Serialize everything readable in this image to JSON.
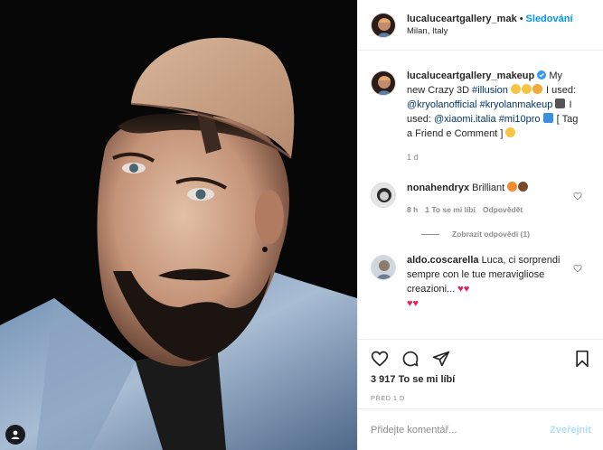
{
  "post": {
    "author": "lucaluceartgallery_mak",
    "follow_label": "Sledování",
    "location": "Milan, Italy"
  },
  "caption": {
    "username": "lucaluceartgallery_makeup",
    "text_1": "My new Crazy 3D",
    "hashtag_illusion": "#illusion",
    "text_2": "I used:",
    "mention_kryolan": "@kryolanofficial",
    "hashtag_kryolan": "#kryolanmakeup",
    "text_3": "I used:",
    "mention_xiaomi": "@xiaomi.italia",
    "hashtag_mi10pro": "#mi10pro",
    "text_4": "[ Tag a Friend e Comment ]",
    "time": "1 d"
  },
  "comments": [
    {
      "username": "nonahendryx",
      "text": "Brilliant",
      "time": "8 h",
      "likes_label": "1 To se mi líbí",
      "reply_label": "Odpovědět",
      "view_replies": "Zobrazit odpovědi (1)"
    },
    {
      "username": "aldo.coscarella",
      "text": "Luca, ci sorprendi sempre con le tue meravigliose creazioni..."
    }
  ],
  "actions": {
    "likes": "3 917 To se mi líbí",
    "date": "PŘED 1 D"
  },
  "add_comment": {
    "placeholder": "Přidejte komentář...",
    "post_label": "Zveřejnit"
  },
  "colors": {
    "link": "#00376b",
    "follow": "#0095f6",
    "verified": "#3897f0",
    "heart": "#ed4956"
  },
  "icons": [
    "user-tag-icon",
    "verified-icon",
    "heart-icon",
    "comment-icon",
    "share-icon",
    "bookmark-icon"
  ]
}
